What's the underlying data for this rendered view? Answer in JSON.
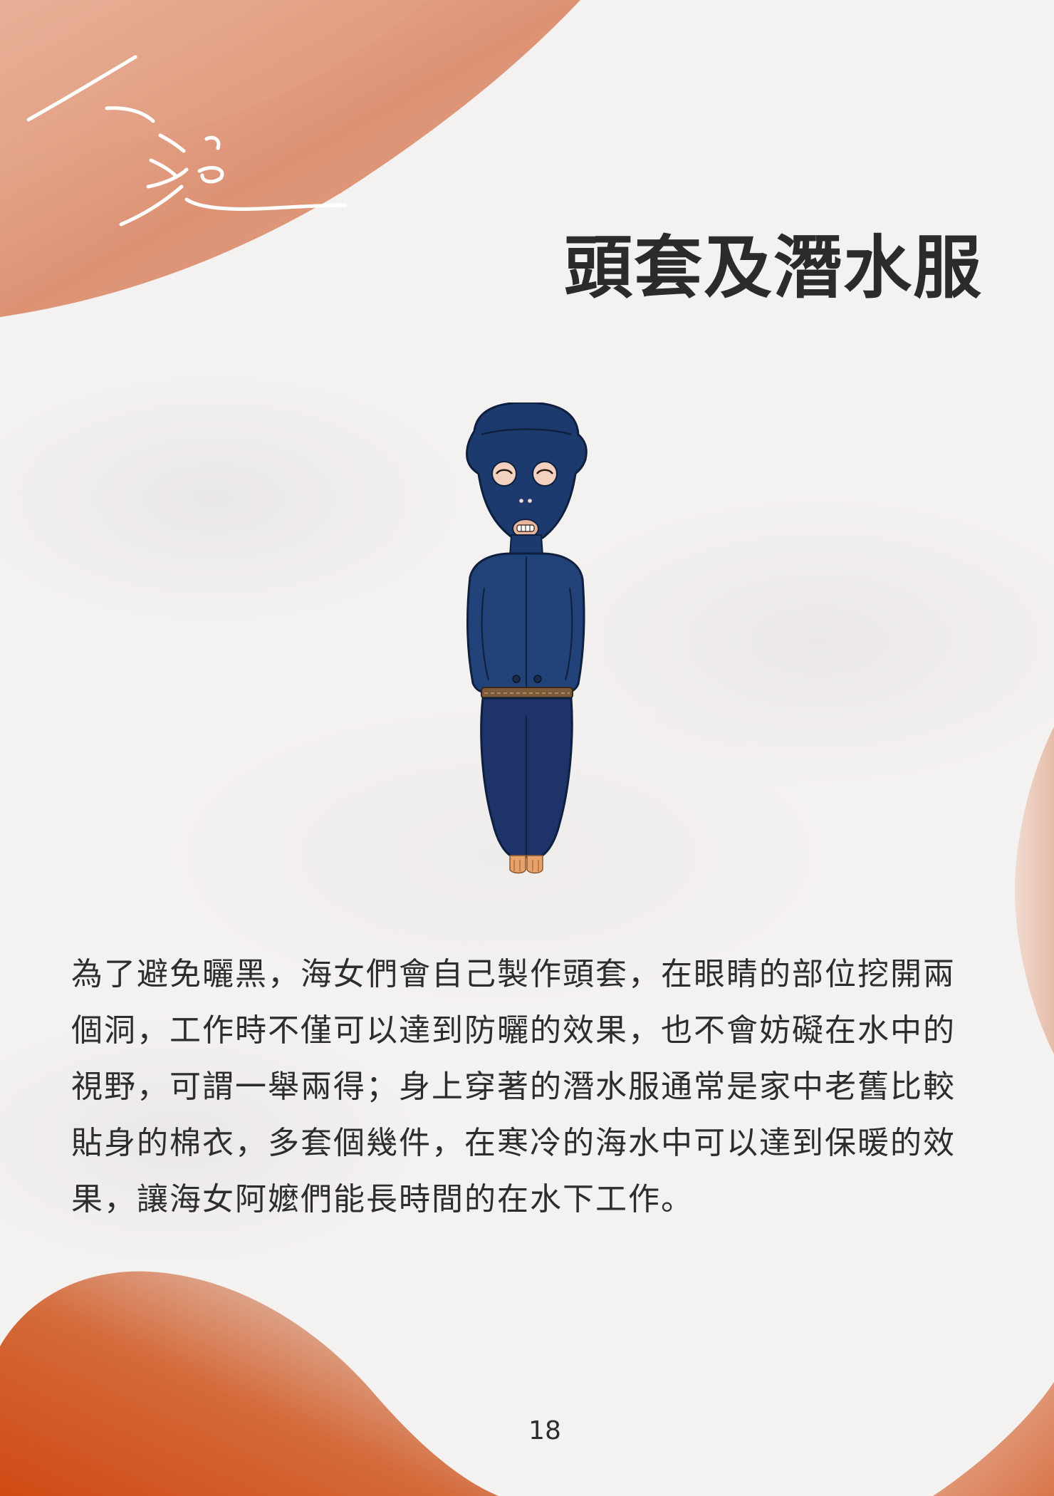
{
  "page": {
    "title": "頭套及潛水服",
    "body": "為了避免曬黑，海女們會自己製作頭套，在眼睛的部位挖開兩個洞，工作時不僅可以達到防曬的效果，也不會妨礙在水中的視野，可謂一舉兩得；身上穿著的潛水服通常是家中老舊比較貼身的棉衣，多套個幾件，在寒冷的海水中可以達到保暖的效果，讓海女阿嬤們能長時間的在水下工作。",
    "page_number": "18"
  },
  "logo": {
    "text": "人泡"
  },
  "colors": {
    "accent": "#d05a28",
    "accent_light": "#e8a98a",
    "suit": "#1d3a6e",
    "text": "#2b2b2b"
  }
}
